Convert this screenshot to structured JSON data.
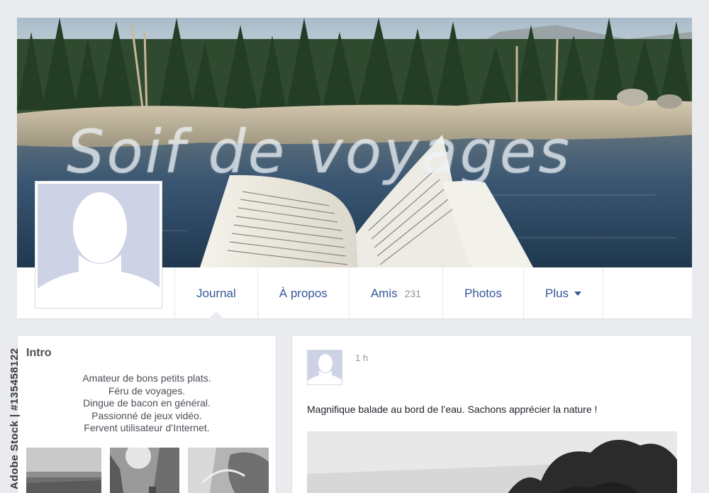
{
  "cover": {
    "title": "Soif de voyages"
  },
  "nav": {
    "tabs": [
      {
        "label": "Journal",
        "active": true
      },
      {
        "label": "À propos"
      },
      {
        "label": "Amis",
        "count": "231"
      },
      {
        "label": "Photos"
      },
      {
        "label": "Plus"
      }
    ]
  },
  "intro": {
    "title": "Intro",
    "lines": [
      "Amateur de bons petits plats.",
      "Féru de voyages.",
      "Dingue de bacon en général.",
      "Passionné de jeux vidéo.",
      "Fervent utilisateur d’Internet."
    ]
  },
  "post": {
    "time": "1 h",
    "text": "Magnifique balade au bord de l’eau. Sachons apprécier la nature !"
  },
  "watermark": {
    "side_text": "Adobe Stock | #135458122"
  },
  "colors": {
    "link_blue": "#365899",
    "page_background": "#e9ebee",
    "silhouette_background": "#cdd3e4"
  },
  "icons": {
    "plus_caret": "chevron-down-icon",
    "avatar": "silhouette-avatar"
  }
}
